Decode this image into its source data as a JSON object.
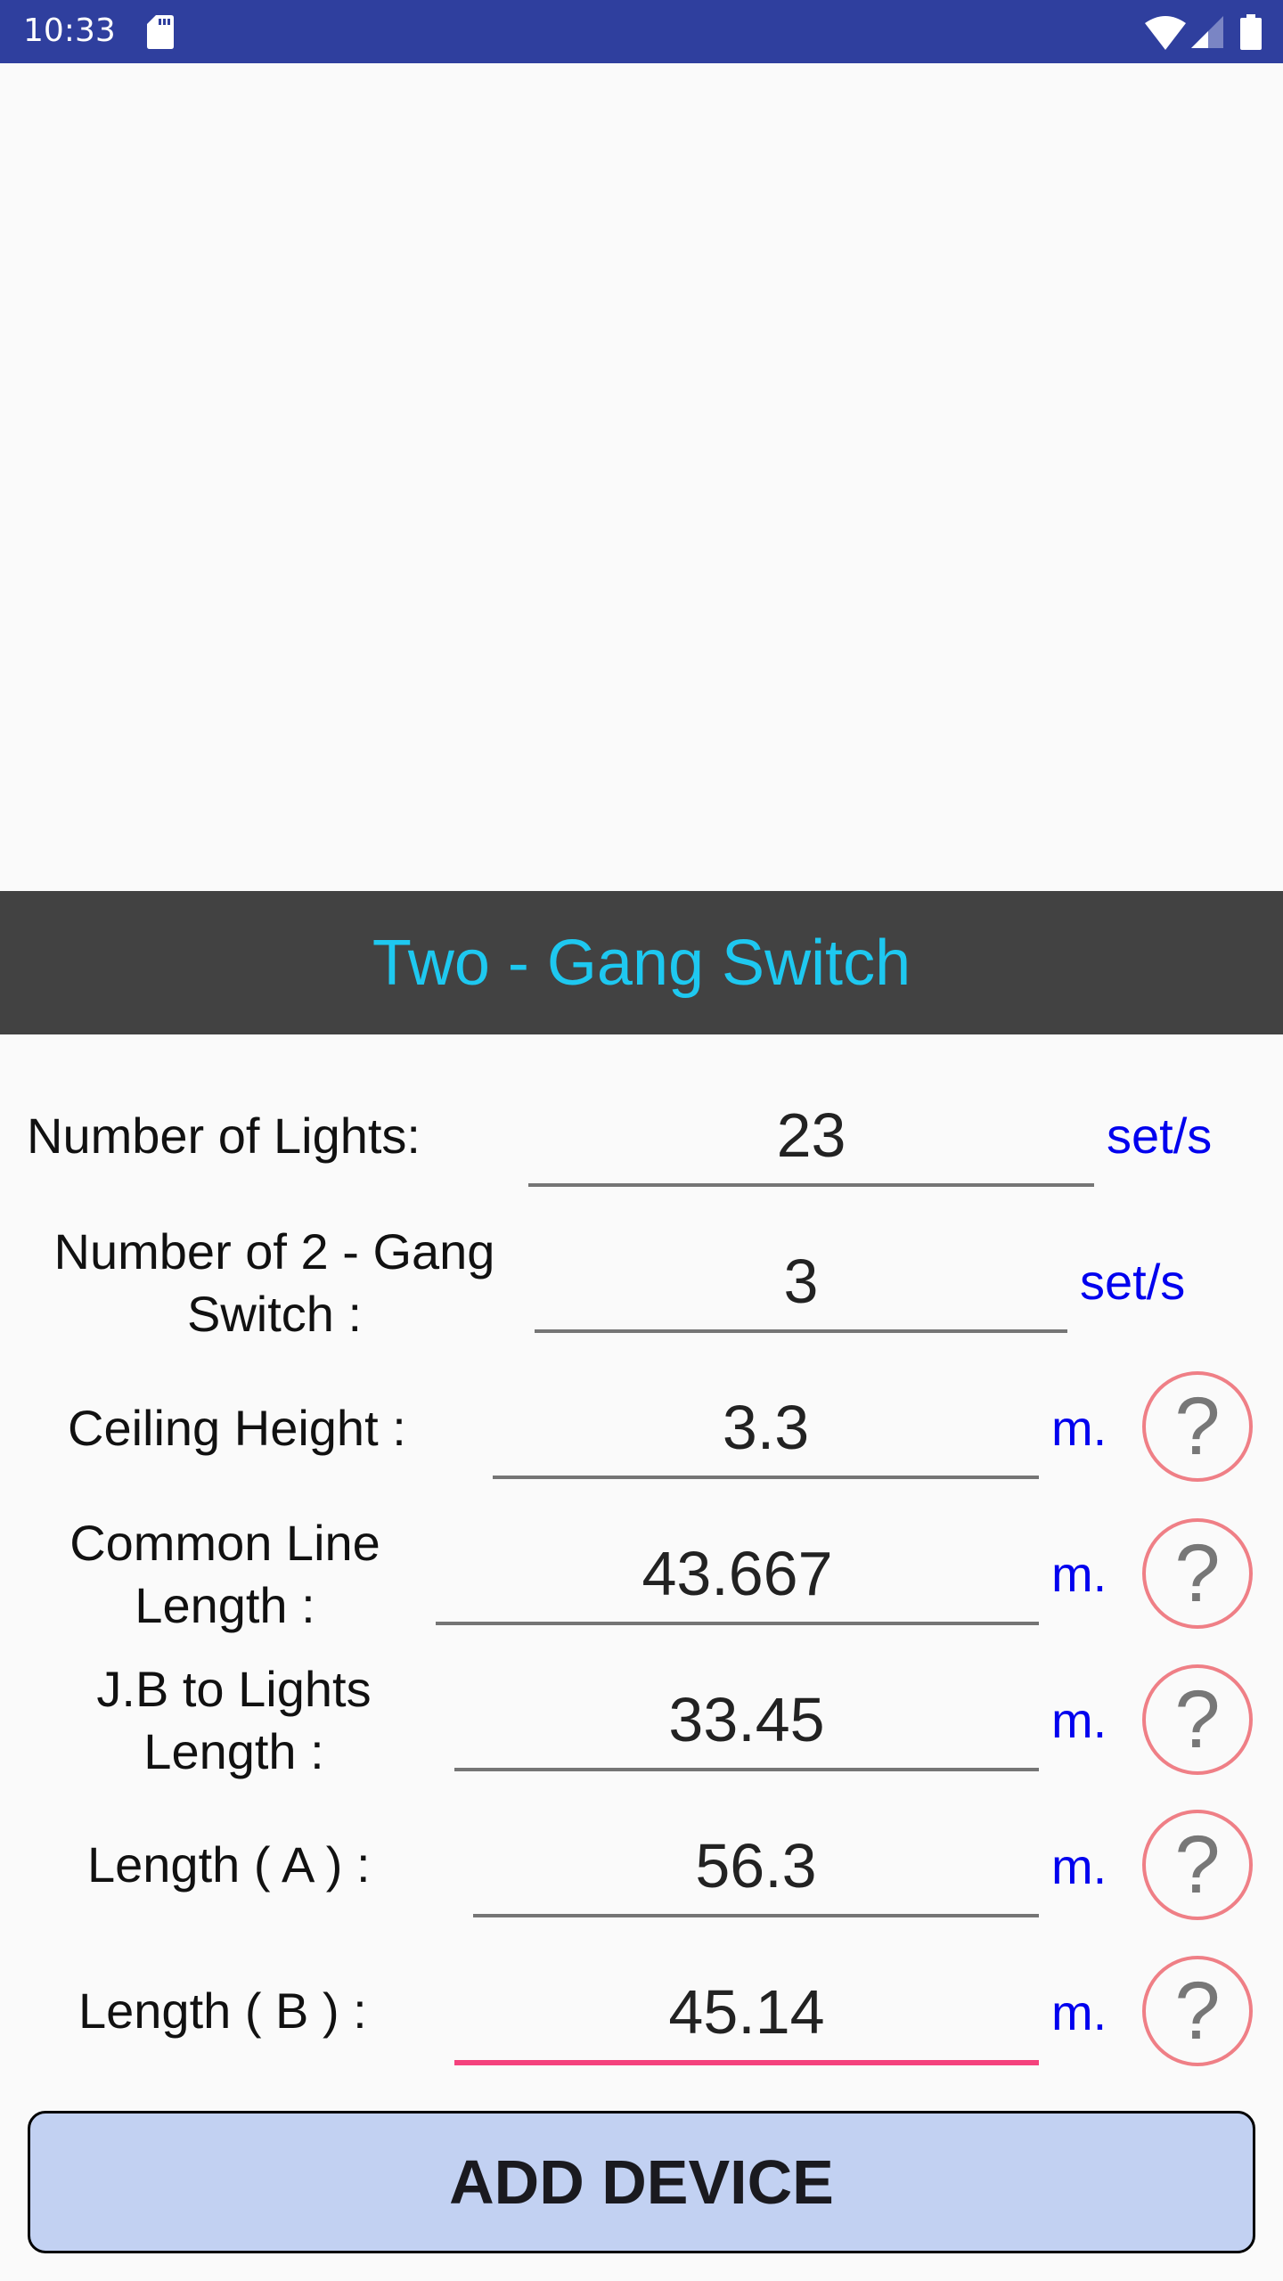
{
  "status_bar": {
    "time": "10:33",
    "icons": [
      "sd-card-icon",
      "wifi-icon",
      "cell-signal-icon",
      "battery-icon"
    ]
  },
  "header": {
    "title": "Two - Gang Switch"
  },
  "form": {
    "rows": [
      {
        "label": "Number of Lights:",
        "value": "23",
        "unit": "set/s",
        "has_help": false
      },
      {
        "label_line1": "Number of 2 - Gang",
        "label_line2": "Switch :",
        "value": "3",
        "unit": "set/s",
        "has_help": false
      },
      {
        "label": "Ceiling Height :",
        "value": "3.3",
        "unit": "m.",
        "has_help": true
      },
      {
        "label_line1": "Common Line",
        "label_line2": "Length :",
        "value": "43.667",
        "unit": "m.",
        "has_help": true
      },
      {
        "label_line1": "J.B to Lights",
        "label_line2": "Length :",
        "value": "33.45",
        "unit": "m.",
        "has_help": true
      },
      {
        "label": "Length ( A ) :",
        "value": "56.3",
        "unit": "m.",
        "has_help": true
      },
      {
        "label": "Length ( B ) :",
        "value": "45.14",
        "unit": "m.",
        "has_help": true,
        "focused": true
      }
    ],
    "help_glyph": "?"
  },
  "actions": {
    "add_device_label": "ADD DEVICE"
  },
  "colors": {
    "status_bar": "#2F3F9E",
    "title_bar": "#424242",
    "title_text": "#1EC8F0",
    "unit_text": "#0000EE",
    "help_border": "#EF7F86",
    "focus_underline": "#F4427D",
    "button_fill": "#C2D1F2"
  }
}
